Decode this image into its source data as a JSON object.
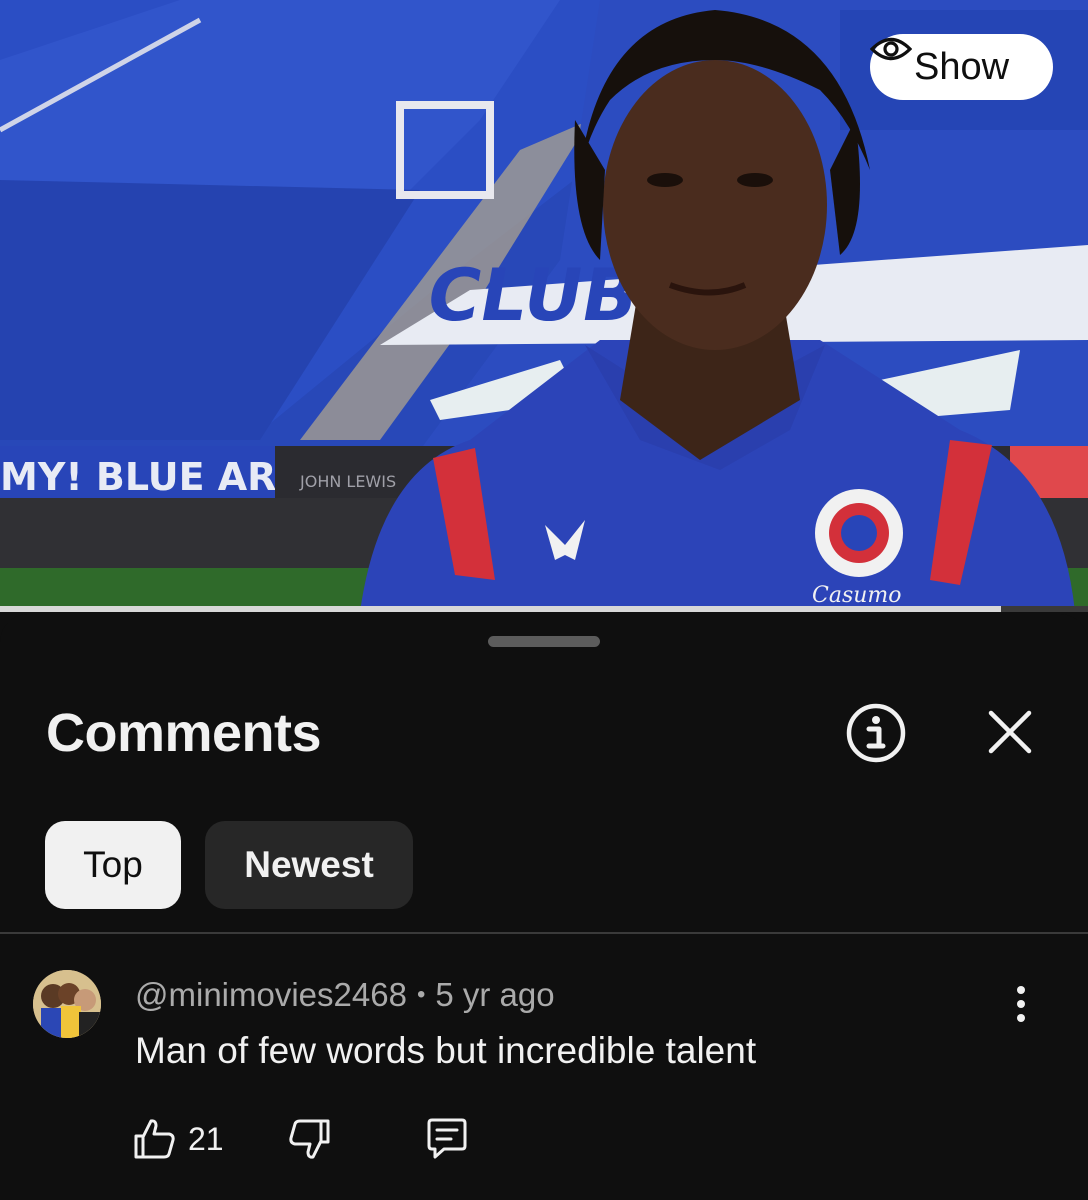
{
  "video": {
    "show_label": "Show",
    "progress_fraction": 0.92,
    "banner_text": "MY! BLUE ARMY!",
    "sponsor_text": "JOHN LEWIS"
  },
  "comments": {
    "title": "Comments",
    "tabs": [
      {
        "label": "Top",
        "active": true
      },
      {
        "label": "Newest",
        "active": false
      }
    ],
    "items": [
      {
        "author": "@minimovies2468",
        "separator": "•",
        "age": "5 yr ago",
        "text": "Man of few words but incredible talent",
        "likes": "21"
      }
    ]
  },
  "icons": {
    "show": "eye-icon",
    "info": "info-icon",
    "close": "close-icon",
    "more": "more-vertical-icon",
    "like": "thumbs-up-icon",
    "dislike": "thumbs-down-icon",
    "reply": "reply-icon"
  },
  "colors": {
    "sheet_bg": "#0f0f0f",
    "chip_active_bg": "#f1f1f1",
    "chip_inactive_bg": "#272727",
    "kit_blue": "#233fa8",
    "kit_red": "#d3303a"
  }
}
